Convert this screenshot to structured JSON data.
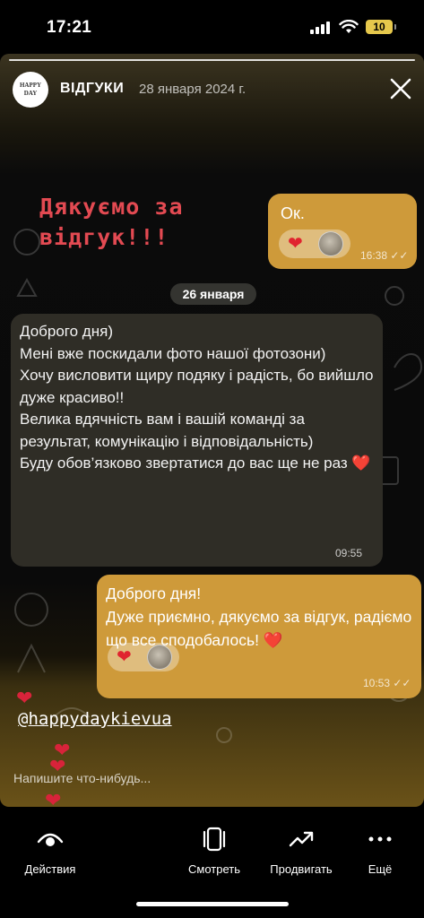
{
  "status_bar": {
    "time": "17:21",
    "battery": "10"
  },
  "story": {
    "title": "ВІДГУКИ",
    "date": "28 января 2024 г.",
    "avatar_text": "HAPPY DAY",
    "thanks_title": "Дякуємо за відгук!!!",
    "messages": [
      {
        "text": "Ок.",
        "time": "16:38",
        "direction": "out"
      },
      {
        "text": "Доброго дня)\nМені вже поскидали фото нашої фотозони)\nХочу висловити щиру подяку і радість, бо вийшло дуже красиво!!\nВелика вдячність вам і вашій команді за результат, комунікацію і відповідальність)\nБуду обов’язково звертатися до вас ще не раз ❤️",
        "time": "09:55",
        "direction": "in"
      },
      {
        "text": "Доброго дня!\nДуже приємно, дякуємо за відгук, радіємо що все сподобалось! ❤️",
        "time": "10:53",
        "direction": "out"
      }
    ],
    "date_separator": "26 января",
    "mention": "@happydaykievua",
    "reply_placeholder": "Напишите что-нибудь..."
  },
  "bottom_bar": {
    "actions": [
      {
        "label": "Действия",
        "icon": "eye-icon"
      },
      {
        "label": "Смотреть",
        "icon": "carousel-icon"
      },
      {
        "label": "Продвигать",
        "icon": "trend-up-icon"
      },
      {
        "label": "Ещё",
        "icon": "more-dots-icon"
      }
    ]
  },
  "colors": {
    "outgoing_bubble": "#ce9a3a",
    "incoming_bubble": "#2f2d26",
    "title_red": "#e34a52",
    "heart": "#e0242f"
  }
}
